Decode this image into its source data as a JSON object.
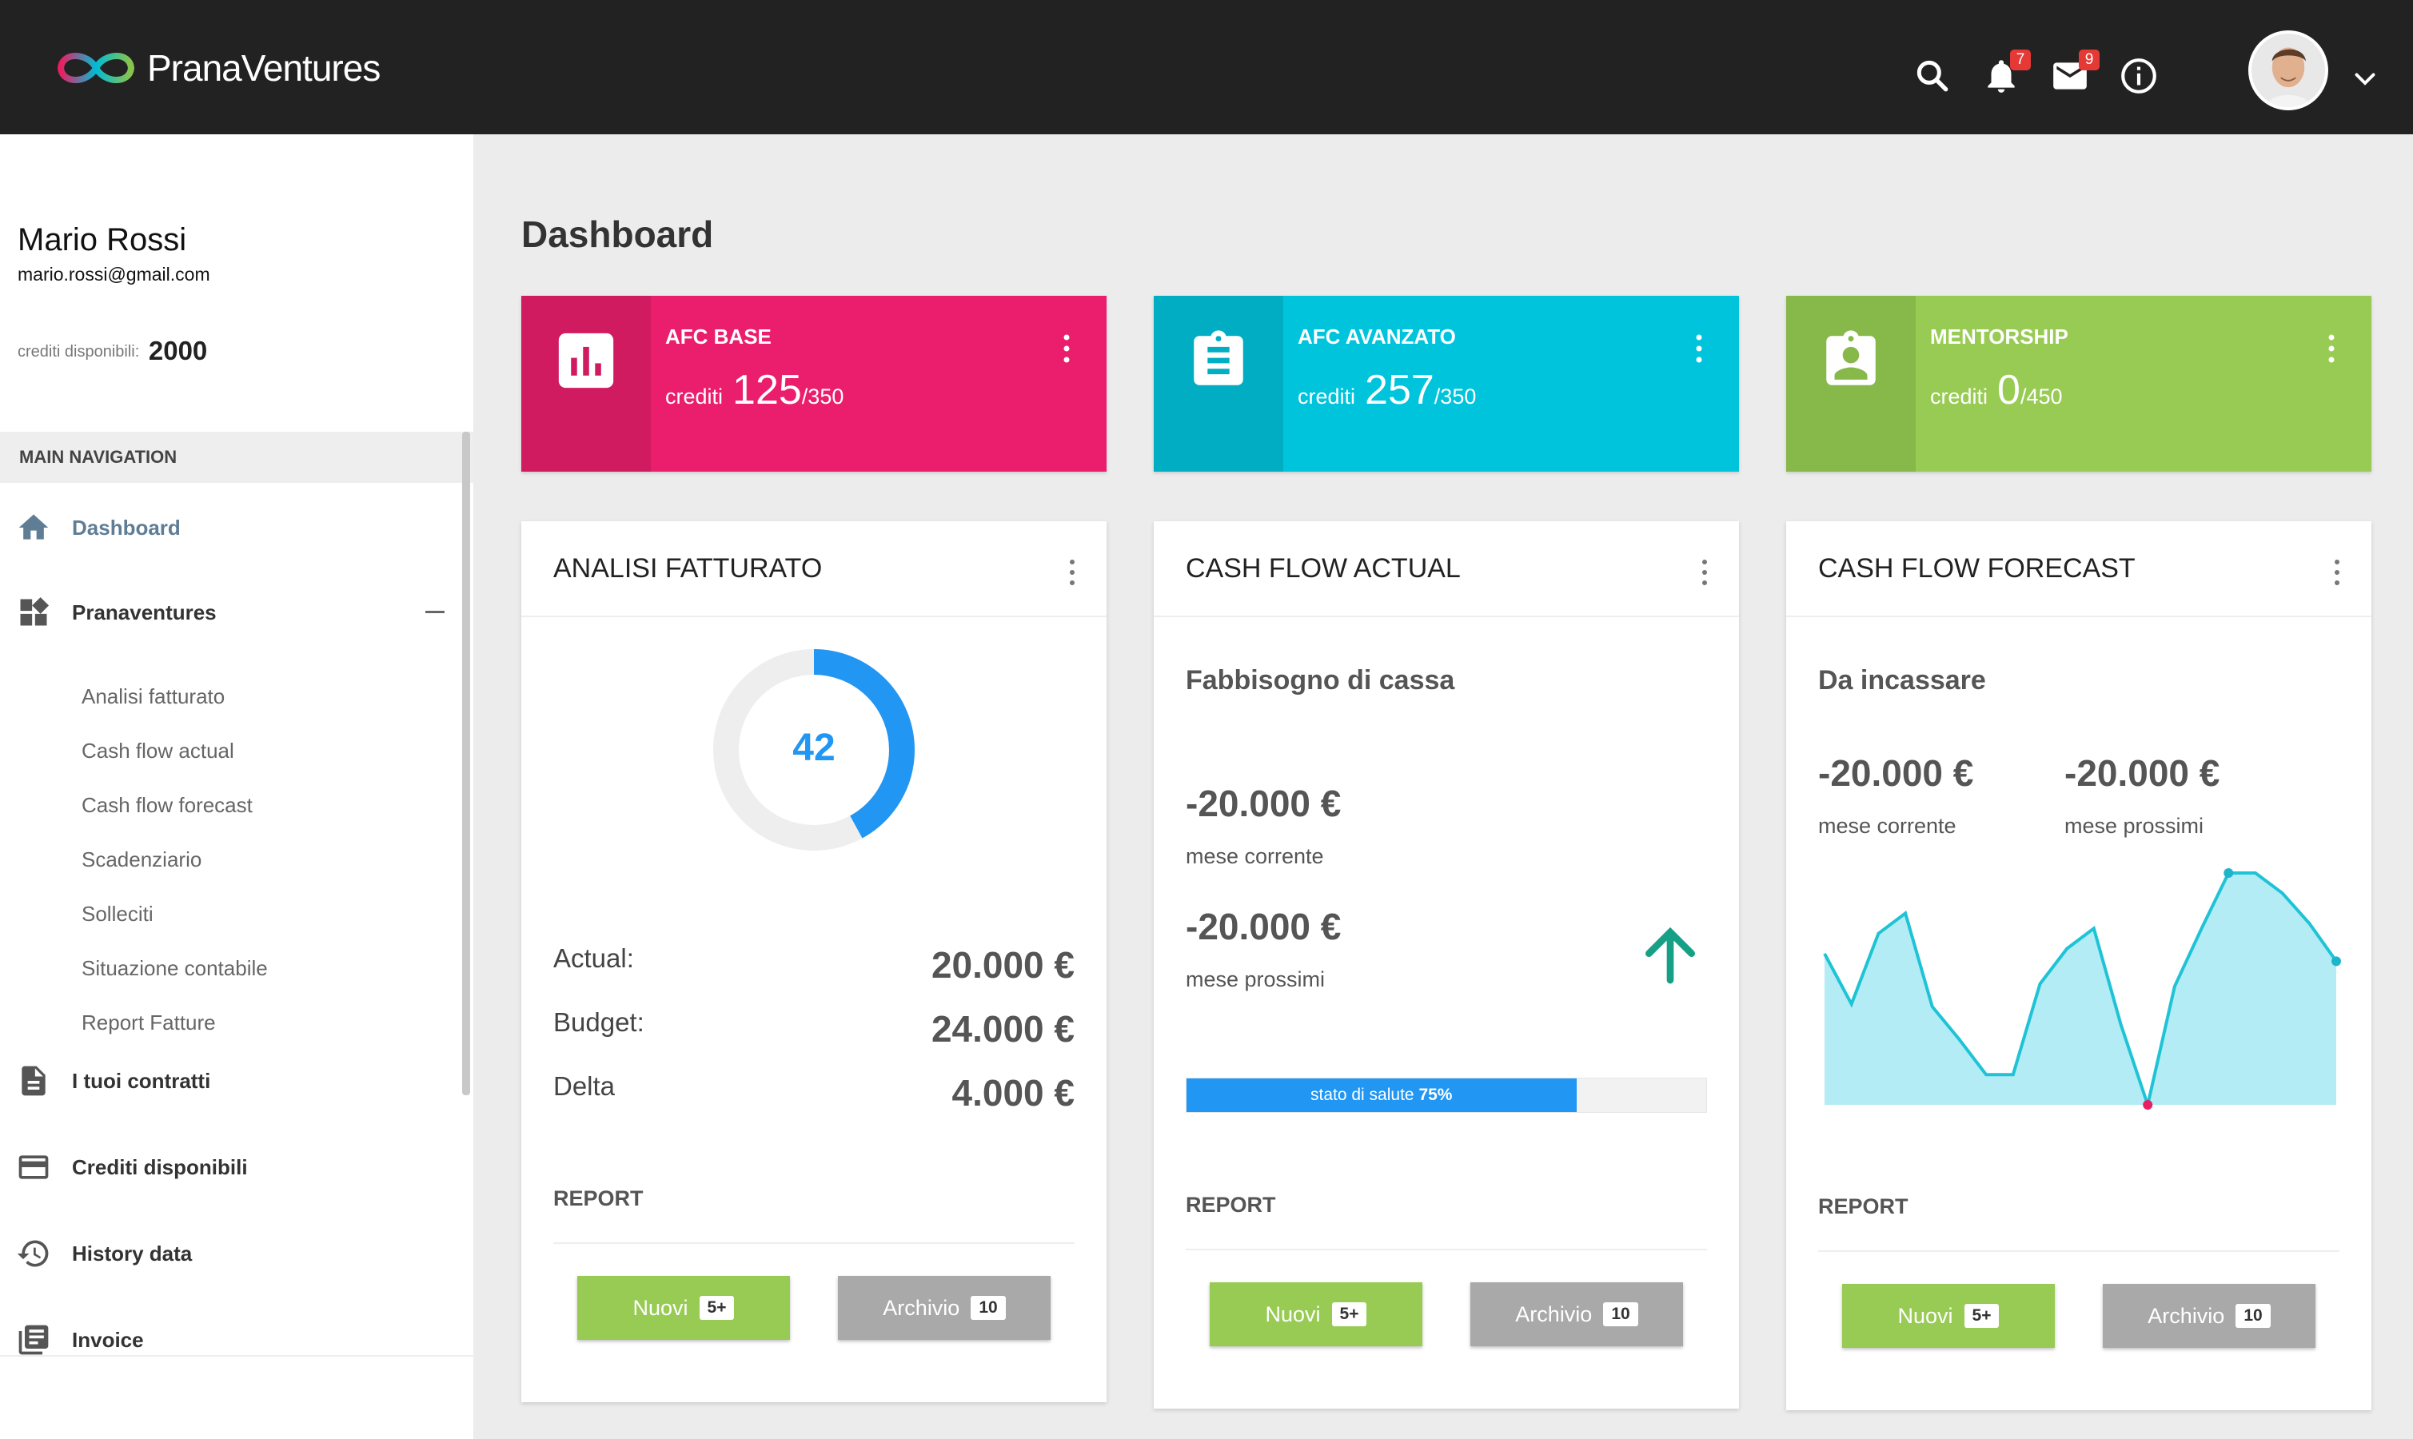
{
  "brand": {
    "prefix": "Prana",
    "suffix": "Ventures"
  },
  "header": {
    "notifications_count": "7",
    "messages_count": "9"
  },
  "user": {
    "name": "Mario Rossi",
    "email": "mario.rossi@gmail.com",
    "credits_label": "crediti disponibili:",
    "credits_value": "2000"
  },
  "nav": {
    "section_title": "MAIN NAVIGATION",
    "items": [
      {
        "label": "Dashboard",
        "icon": "home-icon"
      },
      {
        "label": "Pranaventures",
        "icon": "widgets-icon"
      },
      {
        "label": "I tuoi contratti",
        "icon": "document-icon"
      },
      {
        "label": "Crediti disponibili",
        "icon": "credit-card-icon"
      },
      {
        "label": "History data",
        "icon": "history-icon"
      },
      {
        "label": "Invoice",
        "icon": "invoice-icon"
      }
    ],
    "sub_items": [
      "Analisi fatturato",
      "Cash flow actual",
      "Cash flow forecast",
      "Scadenziario",
      "Solleciti",
      "Situazione contabile",
      "Report Fatture"
    ]
  },
  "page": {
    "title": "Dashboard"
  },
  "stats": [
    {
      "title": "AFC BASE",
      "label": "crediti",
      "value": "125",
      "total": "/350",
      "color": "#ea1e6c",
      "color_dark": "#d11b60",
      "icon": "bar-chart-icon"
    },
    {
      "title": "AFC AVANZATO",
      "label": "crediti",
      "value": "257",
      "total": "/350",
      "color": "#00c4dc",
      "color_dark": "#00adc3",
      "icon": "clipboard-list-icon"
    },
    {
      "title": "MENTORSHIP",
      "label": "crediti",
      "value": "0",
      "total": "/450",
      "color": "#98cb54",
      "color_dark": "#87b84a",
      "icon": "badge-user-icon"
    }
  ],
  "analisi": {
    "title": "ANALISI FATTURATO",
    "donut_value": "42",
    "donut_fraction": 0.42,
    "rows": [
      {
        "label": "Actual:",
        "value": "20.000 €"
      },
      {
        "label": "Budget:",
        "value": "24.000 €"
      },
      {
        "label": "Delta",
        "value": "4.000 €"
      }
    ],
    "report_label": "REPORT",
    "btn_new": "Nuovi",
    "btn_new_count": "5+",
    "btn_archive": "Archivio",
    "btn_archive_count": "10"
  },
  "cashflow_actual": {
    "title": "CASH FLOW ACTUAL",
    "subtitle": "Fabbisogno di cassa",
    "current_value": "-20.000 €",
    "current_label": "mese corrente",
    "next_value": "-20.000 €",
    "next_label": "mese prossimi",
    "health_label": "stato di salute",
    "health_value": "75%",
    "health_fraction": 0.75,
    "report_label": "REPORT",
    "btn_new": "Nuovi",
    "btn_new_count": "5+",
    "btn_archive": "Archivio",
    "btn_archive_count": "10"
  },
  "cashflow_forecast": {
    "title": "CASH FLOW FORECAST",
    "subtitle": "Da incassare",
    "current_value": "-20.000 €",
    "current_label": "mese corrente",
    "next_value": "-20.000 €",
    "next_label": "mese prossimi",
    "report_label": "REPORT",
    "btn_new": "Nuovi",
    "btn_new_count": "5+",
    "btn_archive": "Archivio",
    "btn_archive_count": "10"
  },
  "chart_data": {
    "type": "area",
    "x": [
      0,
      1,
      2,
      3,
      4,
      5,
      6,
      7,
      8,
      9,
      10,
      11,
      12,
      13,
      14,
      15,
      16,
      17,
      18,
      19
    ],
    "values": [
      48,
      28,
      56,
      64,
      27,
      14,
      0,
      0,
      36,
      50,
      58,
      20,
      -12,
      35,
      58,
      80,
      80,
      72,
      60,
      45
    ],
    "ylim": [
      -12,
      80
    ],
    "markers": [
      {
        "index": 12,
        "color": "#e91e63"
      },
      {
        "index": 15,
        "color": "#1fb4c9"
      },
      {
        "index": 19,
        "color": "#1fb4c9"
      }
    ],
    "line_color": "#1fc3d6",
    "fill_color": "#b3ecf5"
  }
}
